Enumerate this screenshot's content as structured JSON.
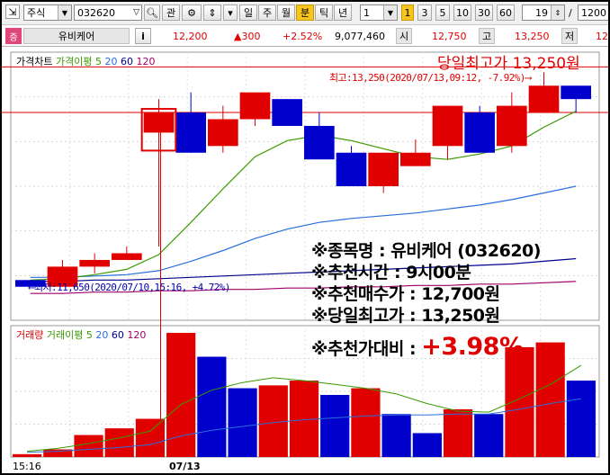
{
  "toolbar": {
    "market": "주식",
    "code": "032620",
    "buttons": [
      "관",
      "일",
      "주",
      "월",
      "분",
      "틱",
      "년"
    ],
    "active_period": "분",
    "period_count": "1",
    "minute_options": [
      "1",
      "3",
      "5",
      "10",
      "30",
      "60"
    ],
    "active_minute": "1",
    "bar_count": "19",
    "separator": "/",
    "total": "1200"
  },
  "quote": {
    "badge": "증",
    "name": "유비케어",
    "info_btn": "i",
    "price": "12,200",
    "change": "▲300",
    "change_pct": "+2.52%",
    "volume": "9,077,460",
    "open_label": "시",
    "open": "12,750",
    "high_label": "고",
    "high": "13,250",
    "low_label": "저",
    "low": "12"
  },
  "price_panel": {
    "legend": [
      "가격차트",
      "가격이평",
      "5",
      "20",
      "60",
      "120"
    ],
    "legend_colors": [
      "#000000",
      "#3a9a00",
      "#3a9a00",
      "#2a6fdb",
      "#000090",
      "#a0006a"
    ],
    "high_marker": "최고:13,250(2020/07/13,09:12, -7.92%)⟶",
    "low_marker": "⟵최저:11,650(2020/07/10,15:16, +4.72%)",
    "headline": "당일최고가 13,250원"
  },
  "volume_panel": {
    "legend": [
      "거래량",
      "거래이평",
      "5",
      "20",
      "60",
      "120"
    ],
    "legend_colors": [
      "#e00000",
      "#3a9a00",
      "#3a9a00",
      "#2a6fdb",
      "#000090",
      "#a0006a"
    ]
  },
  "x_labels": [
    "15:16",
    "07/13"
  ],
  "overlay": {
    "line1": "※종목명 : 유비케어 (032620)",
    "line2": "※추천시간 : 9시00분",
    "line3": "※추천매수가 : 12,700원",
    "line4": "※당일최고가 : 13,250원",
    "line5_label": "※추천가대비 : ",
    "line5_value": "+3.98%"
  },
  "colors": {
    "up": "#e00000",
    "down": "#0000cc",
    "ma5": "#3a9a00",
    "ma20": "#2a6fdb",
    "ma60": "#000090",
    "ma120": "#a0006a"
  },
  "chart_data": {
    "type": "candlestick",
    "y_range": [
      11400,
      13400
    ],
    "candles": [
      {
        "open": 11700,
        "close": 11650,
        "high": 11700,
        "low": 11650
      },
      {
        "open": 11650,
        "close": 11800,
        "high": 11850,
        "low": 11650
      },
      {
        "open": 11800,
        "close": 11850,
        "high": 11900,
        "low": 11750
      },
      {
        "open": 11850,
        "close": 11900,
        "high": 11950,
        "low": 11850
      },
      {
        "open": 12800,
        "close": 12950,
        "high": 13050,
        "low": 11950
      },
      {
        "open": 12950,
        "close": 12650,
        "high": 13100,
        "low": 12650
      },
      {
        "open": 12700,
        "close": 12900,
        "high": 13000,
        "low": 12650
      },
      {
        "open": 12900,
        "close": 13100,
        "high": 13100,
        "low": 12850
      },
      {
        "open": 13050,
        "close": 12850,
        "high": 13050,
        "low": 12850
      },
      {
        "open": 12850,
        "close": 12600,
        "high": 12950,
        "low": 12600
      },
      {
        "open": 12650,
        "close": 12400,
        "high": 12700,
        "low": 12400
      },
      {
        "open": 12400,
        "close": 12650,
        "high": 12650,
        "low": 12350
      },
      {
        "open": 12550,
        "close": 12650,
        "high": 12750,
        "low": 12550
      },
      {
        "open": 12700,
        "close": 13000,
        "high": 13000,
        "low": 12600
      },
      {
        "open": 12950,
        "close": 12650,
        "high": 13000,
        "low": 12650
      },
      {
        "open": 12700,
        "close": 13000,
        "high": 13100,
        "low": 12650
      },
      {
        "open": 12950,
        "close": 13150,
        "high": 13250,
        "low": 12950
      },
      {
        "open": 13150,
        "close": 13050,
        "high": 13150,
        "low": 12950
      }
    ],
    "ma5": [
      11700,
      11710,
      11740,
      11780,
      11890,
      12130,
      12380,
      12620,
      12740,
      12780,
      12740,
      12680,
      12620,
      12600,
      12640,
      12700,
      12840,
      12960
    ],
    "ma20": [
      11720,
      11720,
      11730,
      11740,
      11770,
      11840,
      11920,
      12010,
      12080,
      12130,
      12160,
      12180,
      12200,
      12230,
      12260,
      12300,
      12350,
      12400
    ],
    "ma60": [
      11690,
      11690,
      11700,
      11700,
      11710,
      11720,
      11730,
      11740,
      11750,
      11760,
      11770,
      11780,
      11790,
      11800,
      11810,
      11820,
      11840,
      11860
    ],
    "ma120": [
      11600,
      11600,
      11610,
      11610,
      11620,
      11620,
      11630,
      11630,
      11640,
      11640,
      11650,
      11650,
      11660,
      11660,
      11670,
      11670,
      11680,
      11690
    ],
    "volume": [
      30,
      80,
      230,
      300,
      400,
      1300,
      1050,
      720,
      750,
      800,
      650,
      720,
      450,
      250,
      500,
      450,
      1150,
      1200,
      800
    ],
    "volume_range": [
      0,
      1300
    ],
    "volume_ma5": [
      60,
      90,
      140,
      200,
      270,
      550,
      700,
      780,
      830,
      800,
      760,
      720,
      660,
      560,
      480,
      470,
      610,
      760,
      960
    ],
    "volume_ma20": [
      50,
      60,
      80,
      100,
      130,
      220,
      280,
      320,
      360,
      390,
      410,
      430,
      440,
      440,
      450,
      450,
      500,
      560,
      610
    ],
    "high_line": 13250,
    "low_line": 11650,
    "reference_line": 12950
  }
}
